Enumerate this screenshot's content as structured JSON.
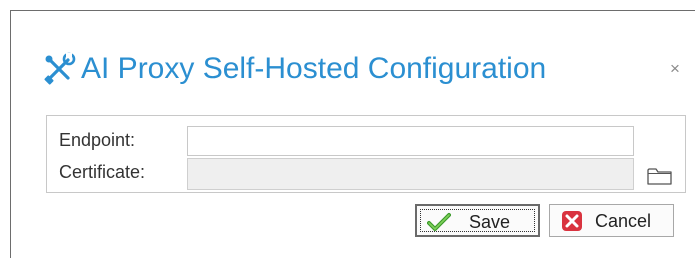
{
  "dialog": {
    "title": "AI Proxy Self-Hosted Configuration",
    "title_icon": "tools-icon",
    "title_color": "#2b8fd1",
    "close_label": "×"
  },
  "form": {
    "endpoint": {
      "label": "Endpoint:",
      "value": "",
      "placeholder": ""
    },
    "certificate": {
      "label": "Certificate:",
      "value": "",
      "placeholder": "",
      "browse_icon": "folder-icon"
    }
  },
  "buttons": {
    "save": {
      "label": "Save",
      "icon": "checkmark-icon",
      "icon_color": "#3a9a2a"
    },
    "cancel": {
      "label": "Cancel",
      "icon": "cancel-icon",
      "icon_color": "#d9333f"
    }
  }
}
